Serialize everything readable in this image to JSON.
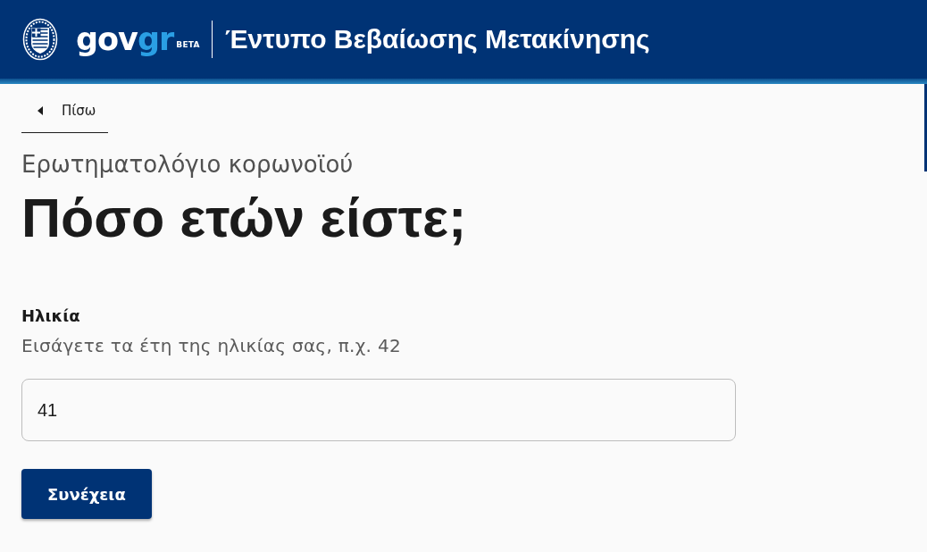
{
  "header": {
    "logo": {
      "parts": [
        {
          "text": "gov",
          "color": "#ffffff"
        },
        {
          "text": "gr",
          "color": "#2a9fe4"
        }
      ],
      "badge": "BETA"
    },
    "title": "Έντυπο Βεβαίωσης Μετακίνησης"
  },
  "back_link": {
    "label": "Πίσω"
  },
  "caption": "Ερωτηματολόγιο κορωνοϊού",
  "heading": "Πόσο ετών είστε;",
  "field": {
    "label": "Ηλικία",
    "hint": "Εισάγετε τα έτη της ηλικίας σας, π.χ. 42",
    "value": "41"
  },
  "buttons": [
    "Συνέχεια"
  ]
}
